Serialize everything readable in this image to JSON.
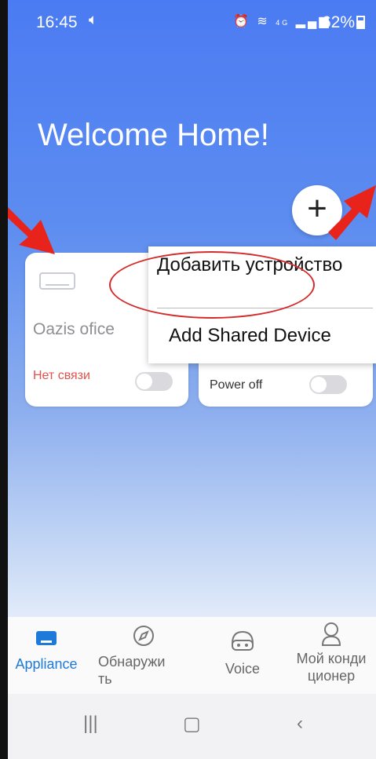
{
  "status_bar": {
    "time": "16:45",
    "battery": "62%",
    "network": "4G"
  },
  "header": {
    "title": "Welcome Home!"
  },
  "add_button": {
    "label": "+"
  },
  "devices": [
    {
      "name": "Oazis ofice",
      "status": "Нет связи"
    },
    {
      "name": "",
      "status": "Power off"
    }
  ],
  "menu": {
    "items": [
      "Добавить устройство",
      "Add Shared Device"
    ]
  },
  "bottom_nav": {
    "items": [
      {
        "label": "Appliance",
        "active": true
      },
      {
        "label": "Обнаружи ть"
      },
      {
        "label": "Voice"
      },
      {
        "label": "Мой конди ционер"
      }
    ]
  },
  "colors": {
    "accent": "#1e7ad9",
    "offline": "#e0534c",
    "annotation": "#d42a2a"
  },
  "icons": [
    "volume-icon",
    "alarm-icon",
    "wifi-icon",
    "signal-icon",
    "battery-icon",
    "plus-icon",
    "air-conditioner-icon",
    "compass-icon",
    "voice-icon",
    "user-icon",
    "recents-icon",
    "home-icon",
    "back-icon"
  ]
}
